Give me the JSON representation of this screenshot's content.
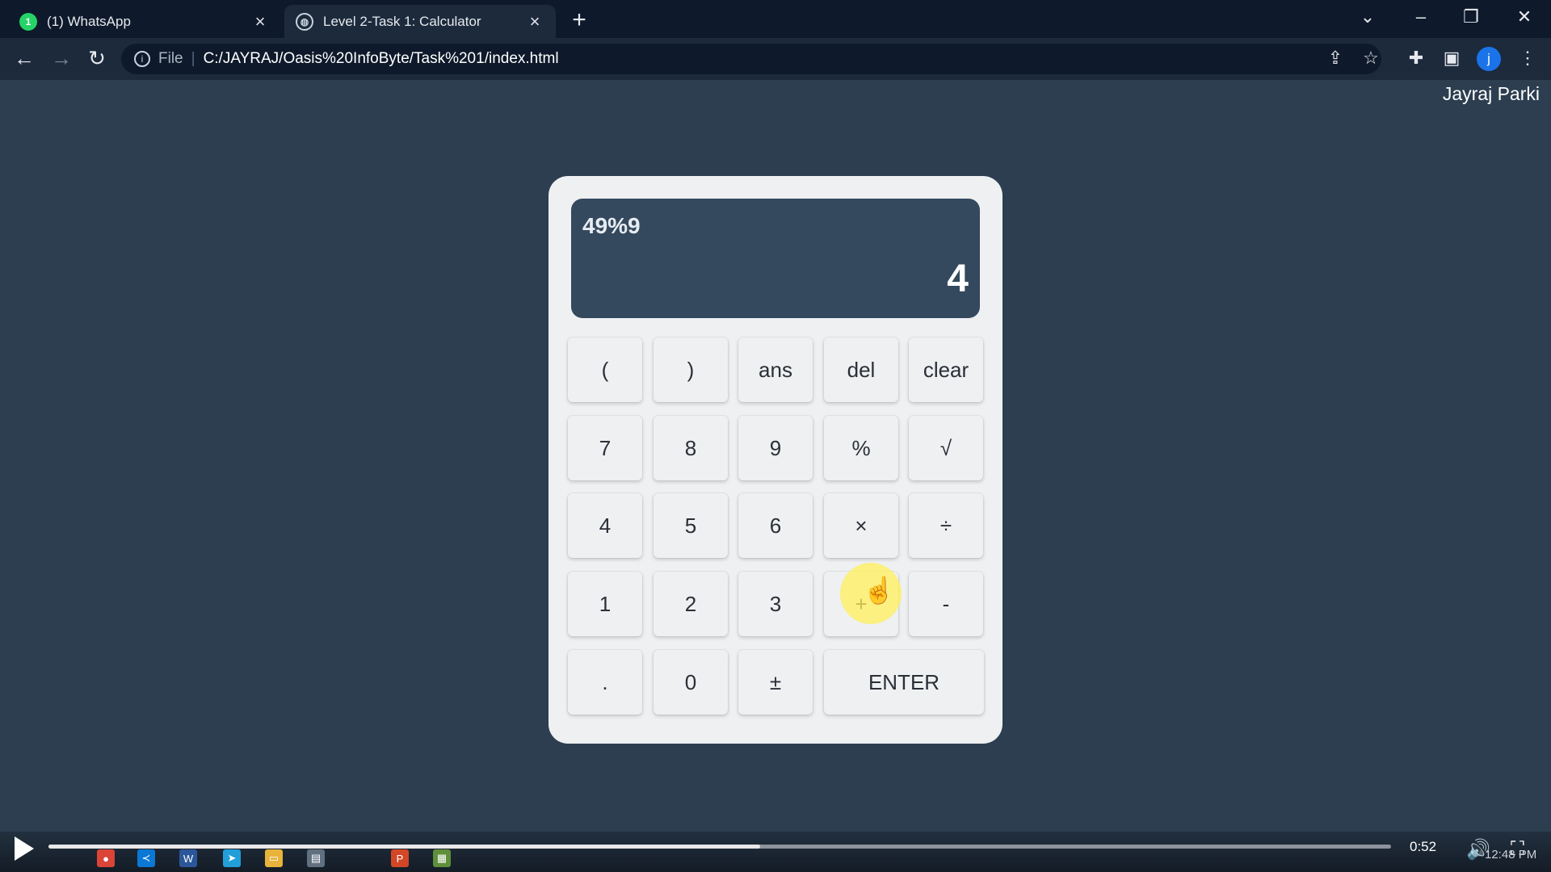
{
  "browser": {
    "tabs": [
      {
        "title": "(1) WhatsApp",
        "favicon": "whatsapp-icon",
        "badge": "1",
        "active": false
      },
      {
        "title": "Level 2-Task 1: Calculator",
        "favicon": "globe-icon",
        "active": true
      }
    ],
    "address_bar": {
      "scheme_label": "File",
      "url": "C:/JAYRAJ/Oasis%20InfoByte/Task%201/index.html"
    },
    "profile_initial": "j"
  },
  "page": {
    "author": "Jayraj Parki",
    "calculator": {
      "expression": "49%9",
      "result": "4",
      "keys": [
        [
          "(",
          ")",
          "ans",
          "del",
          "clear"
        ],
        [
          "7",
          "8",
          "9",
          "%",
          "√"
        ],
        [
          "4",
          "5",
          "6",
          "×",
          "÷"
        ],
        [
          "1",
          "2",
          "3",
          "+",
          "-"
        ],
        [
          ".",
          "0",
          "±",
          "ENTER"
        ]
      ]
    }
  },
  "player": {
    "elapsed": "0:52",
    "progress": 0.53
  },
  "taskbar": {
    "clock": "12:48 PM"
  },
  "colors": {
    "page_background": "#2c3e50",
    "display_background": "#34495e",
    "calculator_body": "#eef0f2",
    "cursor_highlight": "#fff05a"
  }
}
